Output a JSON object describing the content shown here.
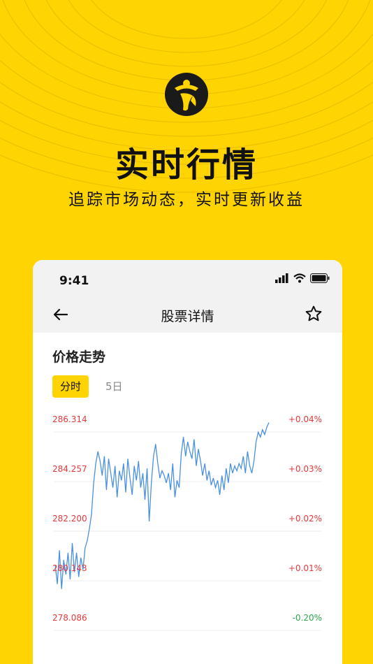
{
  "hero": {
    "title": "实时行情",
    "subtitle": "追踪市场动态，实时更新收益"
  },
  "status_bar": {
    "time": "9:41",
    "icons": [
      "signal-icon",
      "wifi-icon",
      "battery-icon"
    ]
  },
  "nav": {
    "back_icon": "back-arrow-icon",
    "title": "股票详情",
    "favorite_icon": "star-icon"
  },
  "section": {
    "title": "价格走势"
  },
  "tabs": {
    "active": "分时",
    "inactive": "5日"
  },
  "colors": {
    "accent": "#FFD400",
    "up": "#E5393B",
    "down": "#2BA84A",
    "line": "#4A90E2"
  },
  "chart_data": {
    "type": "line",
    "y_left_labels": [
      "286.314",
      "284.257",
      "282.200",
      "280.143",
      "278.086"
    ],
    "y_right_labels": [
      "+0.04%",
      "+0.03%",
      "+0.02%",
      "+0.01%",
      "-0.20%"
    ],
    "ylim": [
      278.086,
      286.314
    ],
    "series": [
      {
        "values": [
          280.4,
          279.6,
          281.0,
          279.4,
          280.6,
          280.0,
          280.9,
          279.8,
          281.3,
          280.1,
          280.9,
          279.9,
          280.7,
          280.2,
          281.1,
          281.4,
          281.9,
          282.5,
          283.8,
          284.6,
          285.1,
          284.7,
          284.1,
          284.9,
          283.5,
          284.8,
          284.2,
          283.6,
          284.5,
          283.2,
          284.3,
          283.9,
          284.6,
          283.4,
          284.8,
          284.0,
          283.3,
          284.5,
          283.9,
          284.7,
          283.6,
          284.2,
          283.1,
          284.4,
          282.2,
          283.8,
          284.9,
          285.4,
          284.6,
          284.0,
          284.3,
          284.1,
          283.8,
          284.2,
          283.5,
          284.6,
          283.2,
          283.9,
          283.6,
          285.0,
          285.7,
          284.9,
          285.5,
          285.1,
          284.8,
          285.6,
          284.5,
          285.2,
          284.7,
          284.1,
          284.6,
          283.9,
          284.3,
          283.7,
          284.0,
          283.6,
          283.9,
          283.3,
          284.1,
          283.5,
          284.4,
          283.8,
          284.6,
          284.2,
          284.5,
          284.3,
          284.6,
          284.4,
          284.9,
          284.2,
          285.1,
          284.5,
          284.2,
          284.7,
          285.5,
          285.9,
          285.7,
          286.0,
          285.8,
          286.1,
          286.3
        ]
      }
    ],
    "grid": true
  }
}
